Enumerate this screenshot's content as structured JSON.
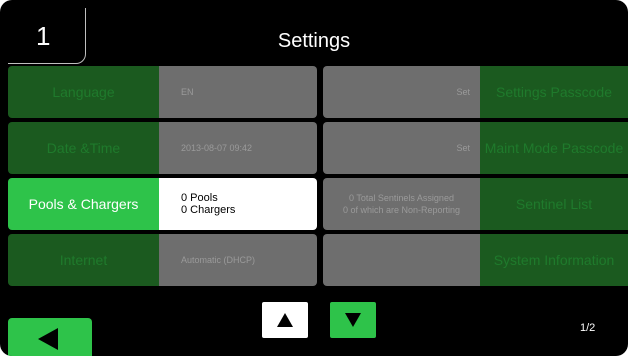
{
  "header": {
    "screen_number": "1",
    "title": "Settings"
  },
  "rows": [
    {
      "left_label": "Language",
      "left_value": "EN",
      "mid_value": "Set",
      "right_label": "Settings Passcode"
    },
    {
      "left_label": "Date &Time",
      "left_value": "2013-08-07  09:42",
      "mid_value": "Set",
      "right_label": "Maint Mode Passcode"
    },
    {
      "left_label": "Pools & Chargers",
      "left_value_line1": "0 Pools",
      "left_value_line2": "0 Chargers",
      "mid_line1": "0 Total Sentinels Assigned",
      "mid_line2": "0 of which are Non-Reporting",
      "right_label": "Sentinel List"
    },
    {
      "left_label": "Internet",
      "left_value": "Automatic (DHCP)",
      "mid_value": "",
      "right_label": "System Information"
    }
  ],
  "footer": {
    "page_indicator": "1/2"
  },
  "colors": {
    "dim_green": "#1b5a1f",
    "bright_green": "#2ec34a",
    "gray_panel": "#6e6e6e"
  }
}
